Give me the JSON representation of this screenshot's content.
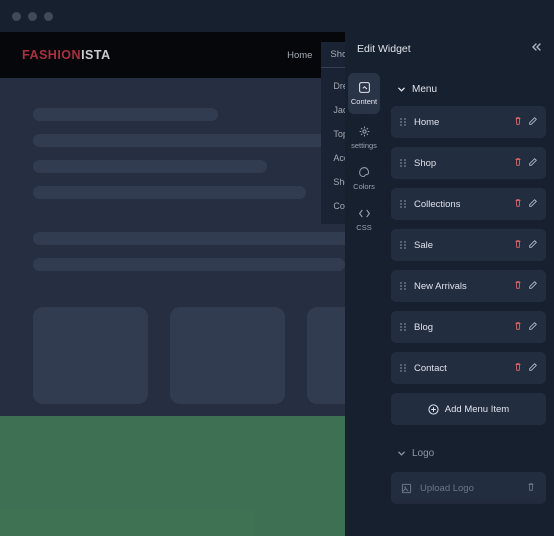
{
  "logo": {
    "part1": "FASHION",
    "part2": "ISTA"
  },
  "nav": [
    {
      "label": "Home",
      "has_submenu": false
    },
    {
      "label": "Shop",
      "has_submenu": true,
      "open": true,
      "submenu": [
        "Dresses",
        "Jackets",
        "Tops",
        "Accessories",
        "Shoes",
        "Coats"
      ]
    },
    {
      "label": "Collections",
      "has_submenu": true
    },
    {
      "label": "Sale",
      "has_submenu": false
    },
    {
      "label": "New Arrivals",
      "has_submenu": false
    }
  ],
  "panel": {
    "title": "Edit Widget",
    "tabs": [
      {
        "id": "content",
        "label": "Content"
      },
      {
        "id": "settings",
        "label": "settings"
      },
      {
        "id": "colors",
        "label": "Colors"
      },
      {
        "id": "css",
        "label": "CSS"
      }
    ],
    "sections": {
      "menu": {
        "title": "Menu",
        "items": [
          "Home",
          "Shop",
          "Collections",
          "Sale",
          "New Arrivals",
          "Blog",
          "Contact"
        ],
        "add_label": "Add Menu Item"
      },
      "logo": {
        "title": "Logo",
        "upload_label": "Upload Logo"
      }
    }
  }
}
